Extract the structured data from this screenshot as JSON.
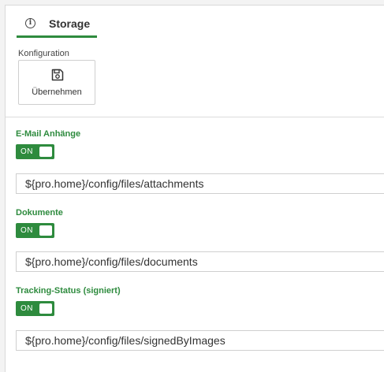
{
  "tab": {
    "label": "Storage",
    "icon": "info-icon"
  },
  "toolbar": {
    "group_caption": "Konfiguration",
    "save_label": "Übernehmen",
    "save_icon": "floppy-disk-icon"
  },
  "fields": [
    {
      "label": "E-Mail Anhänge",
      "toggle": "ON",
      "enabled": true,
      "path": "${pro.home}/config/files/attachments"
    },
    {
      "label": "Dokumente",
      "toggle": "ON",
      "enabled": true,
      "path": "${pro.home}/config/files/documents"
    },
    {
      "label": "Tracking-Status (signiert)",
      "toggle": "ON",
      "enabled": true,
      "path": "${pro.home}/config/files/signedByImages"
    }
  ],
  "colors": {
    "accent": "#2e8b3e",
    "background": "#f3f3f3",
    "panel": "#ffffff"
  }
}
